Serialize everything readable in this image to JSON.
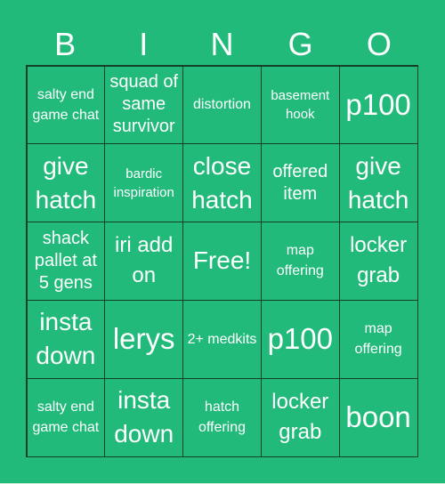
{
  "header": {
    "letters": [
      "B",
      "I",
      "N",
      "G",
      "O"
    ]
  },
  "colors": {
    "background": "#21ba7a",
    "grid_line": "#14402a",
    "text": "#ffffff"
  },
  "board": {
    "cells": [
      "salty end game chat",
      "squad of same survivor",
      "distortion",
      "basement hook",
      "p100",
      "give hatch",
      "bardic inspiration",
      "close hatch",
      "offered item",
      "give hatch",
      "shack pallet at 5 gens",
      "iri add on",
      "Free!",
      "map offering",
      "locker grab",
      "insta down",
      "lerys",
      "2+ medkits",
      "p100",
      "map offering",
      "salty end game chat",
      "insta down",
      "hatch offering",
      "locker grab",
      "boon"
    ]
  }
}
